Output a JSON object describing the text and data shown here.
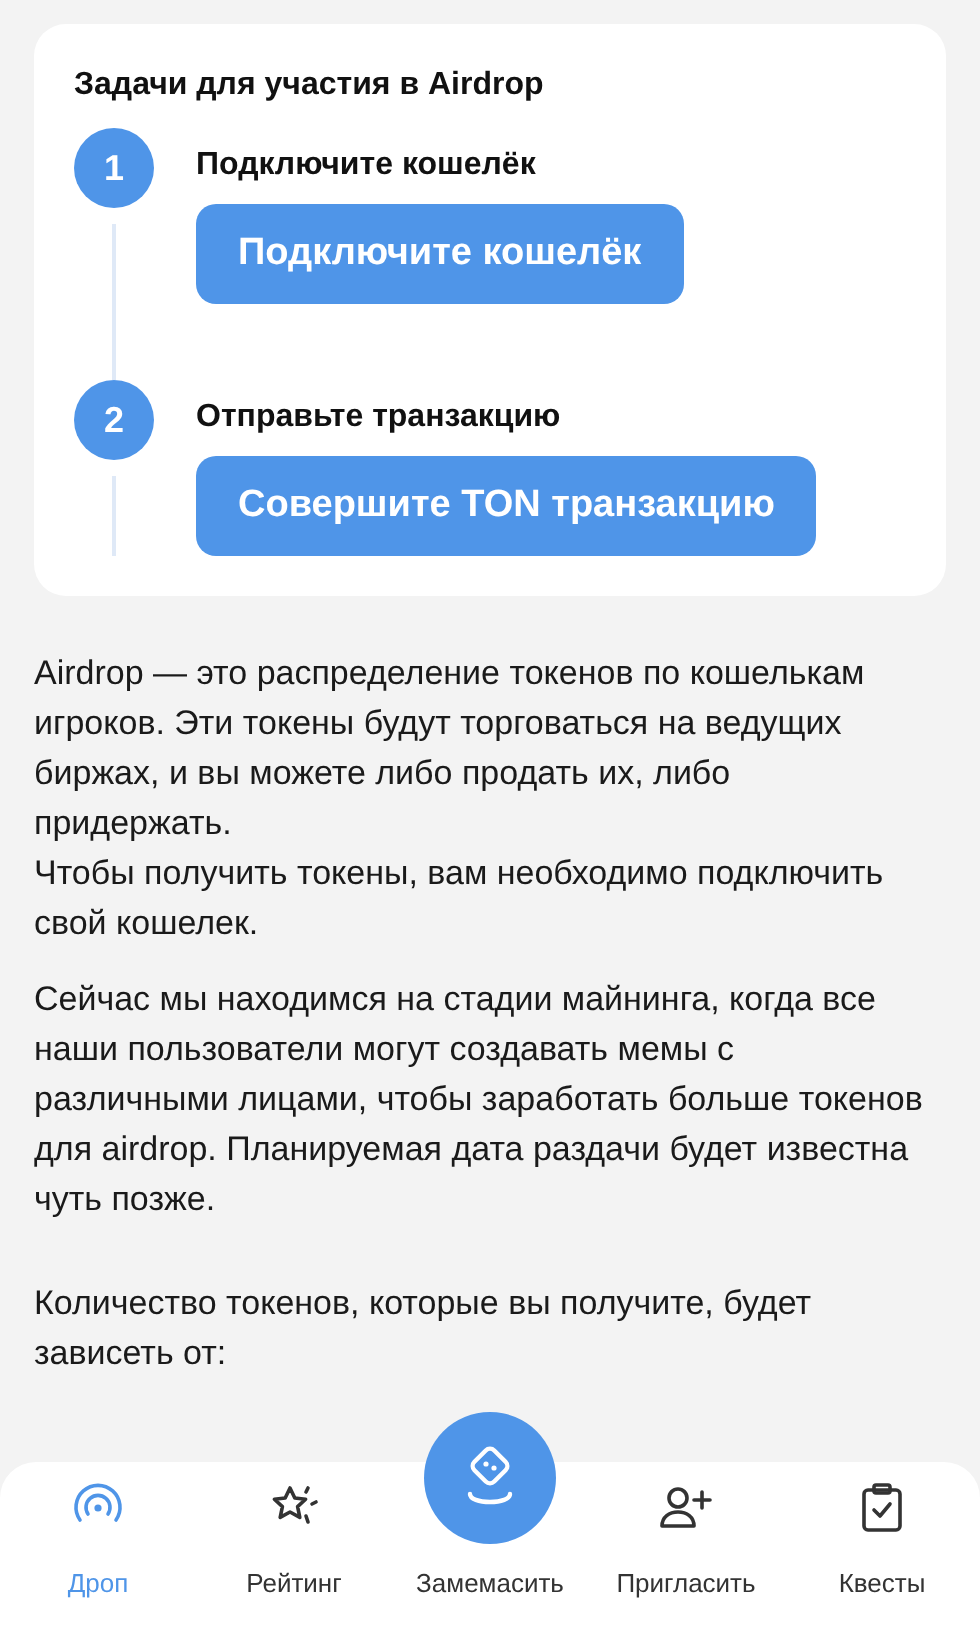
{
  "tasks_card": {
    "title": "Задачи для участия в Airdrop",
    "steps": [
      {
        "number": "1",
        "label": "Подключите кошелёк",
        "button": "Подключите кошелёк"
      },
      {
        "number": "2",
        "label": "Отправьте транзакцию",
        "button": "Совершите TON транзакцию"
      }
    ]
  },
  "paragraphs": [
    "Airdrop — это распределение токенов по кошелькам игроков. Эти токены будут торговаться на ведущих биржах, и вы можете либо продать их, либо придержать.\nЧтобы получить токены, вам необходимо подключить свой кошелек.",
    "Сейчас мы находимся на стадии майнинга, когда все наши пользователи могут создавать мемы с различными лицами, чтобы заработать больше токенов для аirdrop. Планируемая дата раздачи будет известна чуть позже.",
    "Количество токенов, которые вы получите, будет зависеть от:"
  ],
  "bottom_nav": [
    {
      "kind": "drop",
      "label": "Дроп",
      "selected": true
    },
    {
      "kind": "rating",
      "label": "Рейтинг",
      "selected": false
    },
    {
      "kind": "center",
      "label": "Замемасить",
      "selected": false
    },
    {
      "kind": "invite",
      "label": "Пригласить",
      "selected": false
    },
    {
      "kind": "quests",
      "label": "Квесты",
      "selected": false
    }
  ]
}
